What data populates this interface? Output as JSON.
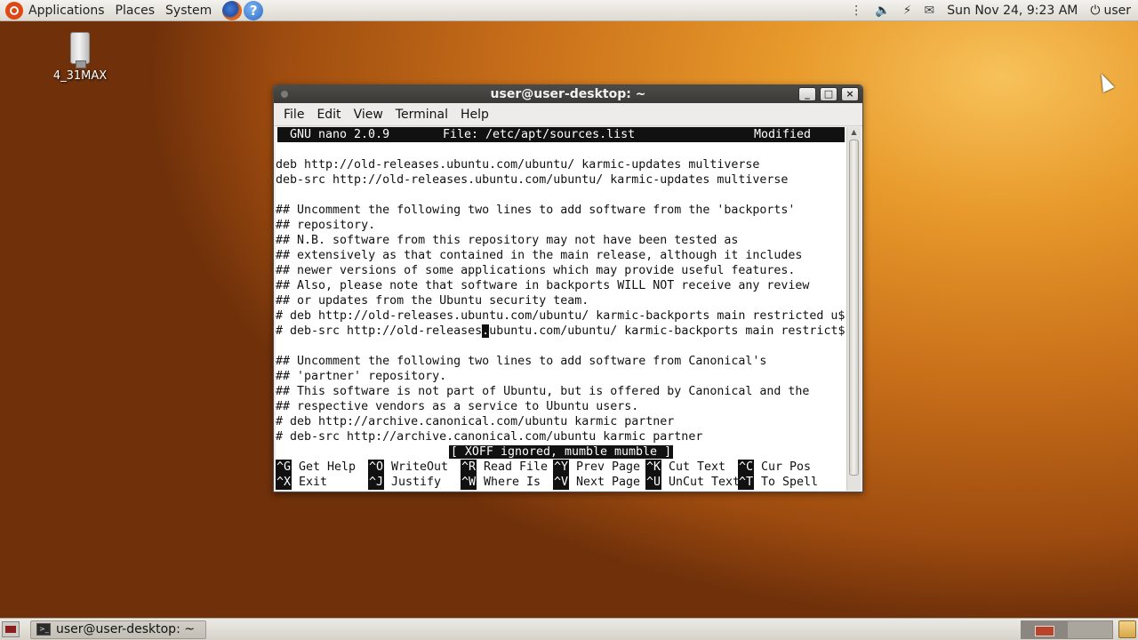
{
  "top_panel": {
    "menus": [
      "Applications",
      "Places",
      "System"
    ],
    "launchers": [
      "firefox-icon",
      "help-icon"
    ],
    "help_glyph": "?",
    "tray_icons": [
      "keyboard-icon",
      "volume-icon",
      "network-icon",
      "mail-icon"
    ],
    "clock": "Sun Nov 24,  9:23 AM",
    "user": "user"
  },
  "desktop": {
    "icons": [
      {
        "label": "4_31MAX",
        "icon": "usb-drive-icon"
      }
    ]
  },
  "window": {
    "title": "user@user-desktop: ~",
    "controls": {
      "minimize": "_",
      "maximize": "□",
      "close": "×"
    },
    "menus": [
      "File",
      "Edit",
      "View",
      "Terminal",
      "Help"
    ]
  },
  "nano": {
    "header": {
      "version": "GNU nano 2.0.9",
      "file": "File: /etc/apt/sources.list",
      "state": "Modified"
    },
    "lines": [
      "",
      "deb http://old-releases.ubuntu.com/ubuntu/ karmic-updates multiverse",
      "deb-src http://old-releases.ubuntu.com/ubuntu/ karmic-updates multiverse",
      "",
      "## Uncomment the following two lines to add software from the 'backports'",
      "## repository.",
      "## N.B. software from this repository may not have been tested as",
      "## extensively as that contained in the main release, although it includes",
      "## newer versions of some applications which may provide useful features.",
      "## Also, please note that software in backports WILL NOT receive any review",
      "## or updates from the Ubuntu security team.",
      "# deb http://old-releases.ubuntu.com/ubuntu/ karmic-backports main restricted u$"
    ],
    "cursor_line": {
      "before": "# deb-src http://old-releases",
      "cursor": ".",
      "after": "ubuntu.com/ubuntu/ karmic-backports main restrict$"
    },
    "lines_after": [
      "",
      "## Uncomment the following two lines to add software from Canonical's",
      "## 'partner' repository.",
      "## This software is not part of Ubuntu, but is offered by Canonical and the",
      "## respective vendors as a service to Ubuntu users.",
      "# deb http://archive.canonical.com/ubuntu karmic partner",
      "# deb-src http://archive.canonical.com/ubuntu karmic partner"
    ],
    "status": "[ XOFF ignored, mumble mumble ]",
    "shortcuts_row1": [
      {
        "key": "^G",
        "label": "Get Help"
      },
      {
        "key": "^O",
        "label": "WriteOut"
      },
      {
        "key": "^R",
        "label": "Read File"
      },
      {
        "key": "^Y",
        "label": "Prev Page"
      },
      {
        "key": "^K",
        "label": "Cut Text"
      },
      {
        "key": "^C",
        "label": "Cur Pos"
      }
    ],
    "shortcuts_row2": [
      {
        "key": "^X",
        "label": "Exit"
      },
      {
        "key": "^J",
        "label": "Justify"
      },
      {
        "key": "^W",
        "label": "Where Is"
      },
      {
        "key": "^V",
        "label": "Next Page"
      },
      {
        "key": "^U",
        "label": "UnCut Text"
      },
      {
        "key": "^T",
        "label": "To Spell"
      }
    ]
  },
  "bottom_panel": {
    "task": "user@user-desktop: ~",
    "workspaces": 2,
    "active_workspace": 1
  }
}
